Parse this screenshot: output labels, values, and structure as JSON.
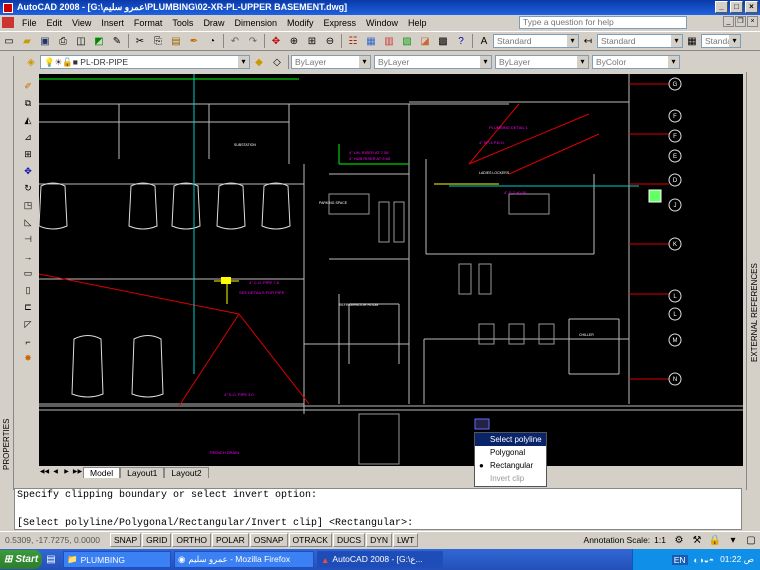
{
  "title": "AutoCAD 2008 - [G:\\عمرو سليم\\PLUMBING\\02-XR-PL-UPPER BASEMENT.dwg]",
  "menu": [
    "File",
    "Edit",
    "View",
    "Insert",
    "Format",
    "Tools",
    "Draw",
    "Dimension",
    "Modify",
    "Express",
    "Window",
    "Help"
  ],
  "help_placeholder": "Type a question for help",
  "toolbar": {
    "text_style": "Standard",
    "dim_style": "Standard",
    "table_style": "Standard"
  },
  "layers": {
    "current_layer": "PL-DR-PIPE",
    "color": "ByLayer",
    "linetype": "ByLayer",
    "lineweight": "ByLayer",
    "plotstyle": "ByColor"
  },
  "tabs": [
    "Model",
    "Layout1",
    "Layout2"
  ],
  "command_lines": [
    "Specify clipping boundary or select invert option:",
    "",
    "[Select polyline/Polygonal/Rectangular/Invert clip] <Rectangular>:"
  ],
  "popup": [
    "Select polyline",
    "Polygonal",
    "Rectangular",
    "Invert clip"
  ],
  "status": {
    "coords": "0.5309, -17.7275, 0.0000",
    "buttons": [
      "SNAP",
      "GRID",
      "ORTHO",
      "POLAR",
      "OSNAP",
      "OTRACK",
      "DUCS",
      "DYN",
      "LWT"
    ],
    "annotation_scale_label": "Annotation Scale:",
    "annotation_scale": "1:1"
  },
  "side_labels": {
    "left": "PROPERTIES",
    "right": "EXTERNAL REFERENCES"
  },
  "taskbar": {
    "start": "Start",
    "tasks": [
      "PLUMBING",
      "عمرو سليم - Mozilla Firefox",
      "AutoCAD 2008 - [G:\\ع..."
    ],
    "lang": "EN",
    "clock": "01:22 ص"
  },
  "grid_bubbles": [
    "G",
    "F",
    "F",
    "E",
    "D",
    "J",
    "K",
    "L",
    "L",
    "M",
    "N"
  ]
}
